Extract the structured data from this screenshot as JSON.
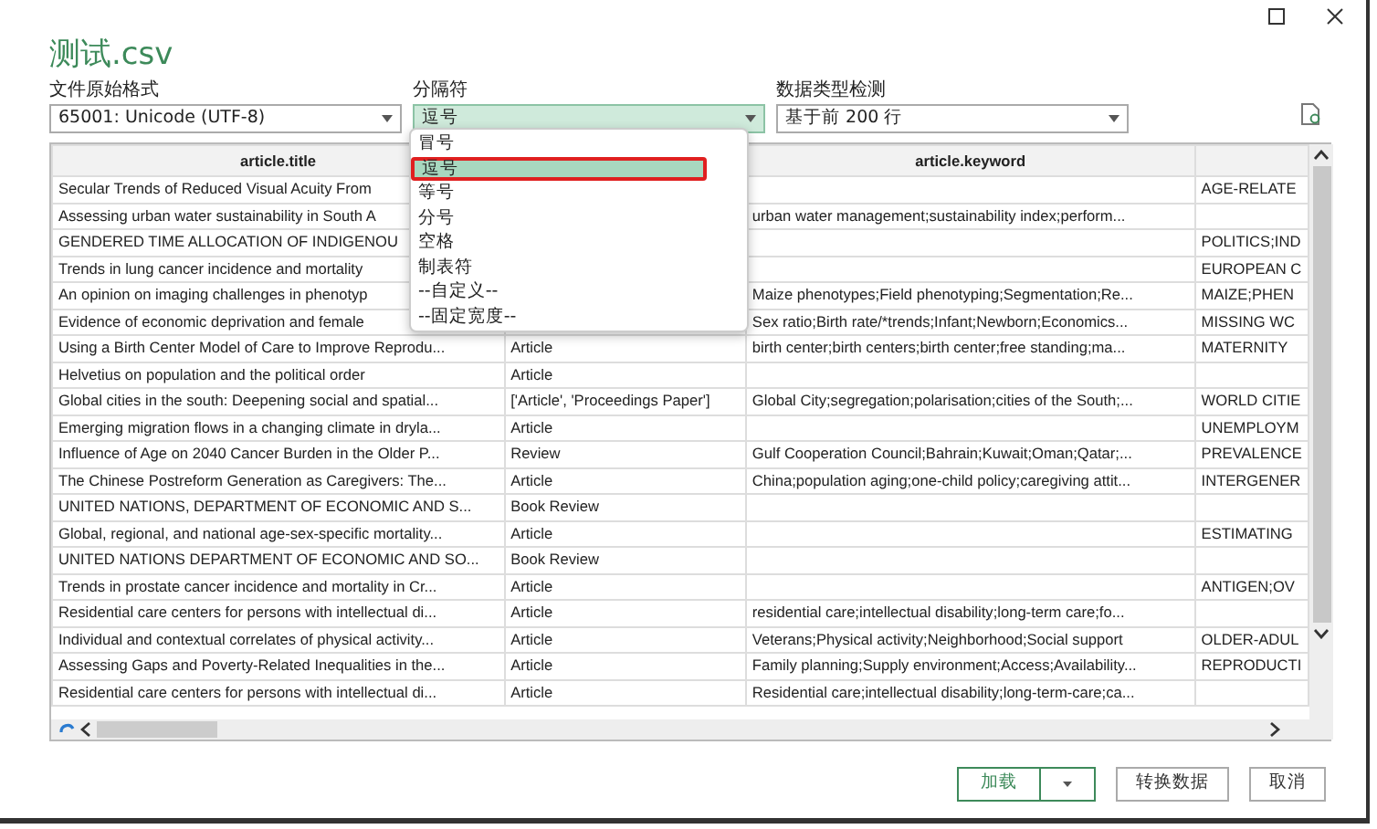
{
  "window": {
    "title": "测试.csv"
  },
  "fields": [
    {
      "label": "文件原始格式",
      "value": "65001: Unicode (UTF-8)",
      "open": false
    },
    {
      "label": "分隔符",
      "value": "逗号",
      "open": true
    },
    {
      "label": "数据类型检测",
      "value": "基于前 200 行",
      "open": false
    }
  ],
  "delimiter_menu": [
    {
      "label": "冒号",
      "selected": false
    },
    {
      "label": "逗号",
      "selected": true
    },
    {
      "label": "等号",
      "selected": false
    },
    {
      "label": "分号",
      "selected": false
    },
    {
      "label": "空格",
      "selected": false
    },
    {
      "label": "制表符",
      "selected": false
    },
    {
      "label": "--自定义--",
      "selected": false
    },
    {
      "label": "--固定宽度--",
      "selected": false
    }
  ],
  "table": {
    "columns": [
      {
        "heading": "article.title"
      },
      {},
      {
        "heading": "article.keyword"
      },
      {}
    ],
    "rows": [
      {
        "title": "Secular Trends of Reduced Visual Acuity From",
        "column_4": "AGE-RELATE"
      },
      {
        "title": "Assessing urban water sustainability in South A",
        "keyword": "urban water management;sustainability index;perform..."
      },
      {
        "title": "GENDERED TIME ALLOCATION OF INDIGENOU",
        "column_4": "POLITICS;IND"
      },
      {
        "title": "Trends in lung cancer incidence and mortality",
        "column_4": "EUROPEAN C"
      },
      {
        "title": "An opinion on imaging challenges in phenotyp",
        "keyword": "Maize phenotypes;Field phenotyping;Segmentation;Re...",
        "column_4": "MAIZE;PHEN"
      },
      {
        "title": "Evidence of economic deprivation and female",
        "keyword": "Sex ratio;Birth rate/*trends;Infant;Newborn;Economics...",
        "column_4": "MISSING WC"
      },
      {
        "title": "Using a Birth Center Model of Care to Improve Reprodu...",
        "type": "Article",
        "keyword": "birth center;birth centers;birth center;free standing;ma...",
        "column_4": "MATERNITY"
      },
      {
        "title": "Helvetius on population and the political order",
        "type": "Article"
      },
      {
        "title": "Global cities in the south: Deepening social and spatial...",
        "type": "['Article', 'Proceedings Paper']",
        "keyword": "Global City;segregation;polarisation;cities of the South;...",
        "column_4": "WORLD CITIE"
      },
      {
        "title": "Emerging migration flows in a changing climate in dryla...",
        "type": "Article",
        "column_4": "UNEMPLOYM"
      },
      {
        "title": "Influence of Age on 2040 Cancer Burden in the Older P...",
        "type": "Review",
        "keyword": "Gulf Cooperation Council;Bahrain;Kuwait;Oman;Qatar;...",
        "column_4": "PREVALENCE"
      },
      {
        "title": "The Chinese Postreform Generation as Caregivers: The...",
        "type": "Article",
        "keyword": "China;population aging;one-child policy;caregiving attit...",
        "column_4": "INTERGENER"
      },
      {
        "title": "UNITED NATIONS, DEPARTMENT OF ECONOMIC AND S...",
        "type": "Book Review"
      },
      {
        "title": "Global, regional, and national age-sex-specific mortality...",
        "type": "Article",
        "column_4": "ESTIMATING"
      },
      {
        "title": "UNITED NATIONS DEPARTMENT OF ECONOMIC AND SO...",
        "type": "Book Review"
      },
      {
        "title": "Trends in prostate cancer incidence and mortality in Cr...",
        "type": "Article",
        "column_4": "ANTIGEN;OV"
      },
      {
        "title": "Residential care centers for persons with intellectual di...",
        "type": "Article",
        "keyword": "residential care;intellectual disability;long-term care;fo..."
      },
      {
        "title": "Individual and contextual correlates of physical activity...",
        "type": "Article",
        "keyword": "Veterans;Physical activity;Neighborhood;Social support",
        "column_4": "OLDER-ADUL"
      },
      {
        "title": "Assessing Gaps and Poverty-Related Inequalities in the...",
        "type": "Article",
        "keyword": "Family planning;Supply environment;Access;Availability...",
        "column_4": "REPRODUCTI"
      },
      {
        "title": "Residential care centers for persons with intellectual di...",
        "type": "Article",
        "keyword": "Residential care;intellectual disability;long-term-care;ca..."
      }
    ]
  },
  "buttons": [
    {
      "label": "加载",
      "kind": "split"
    },
    {
      "label": "转换数据",
      "kind": "plain"
    },
    {
      "label": "取消",
      "kind": "plain"
    }
  ]
}
